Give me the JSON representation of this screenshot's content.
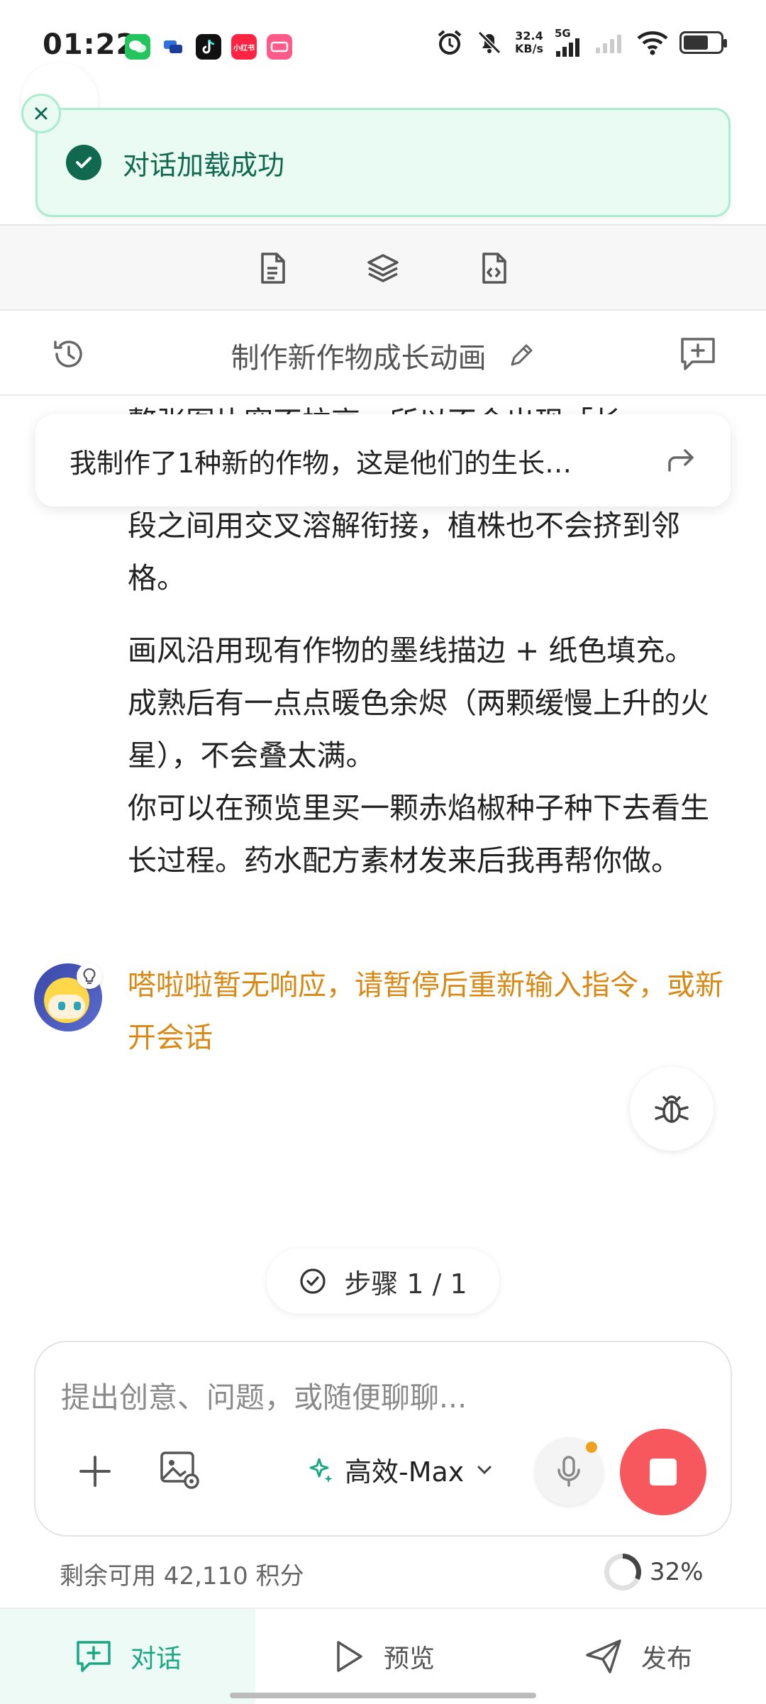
{
  "status_bar": {
    "time": "01:22",
    "net_speed_value": "32.4",
    "net_speed_unit": "KB/s",
    "network": "5G",
    "app_icon_label": "小红书"
  },
  "toast": {
    "message": "对话加载成功"
  },
  "chat": {
    "title": "制作新作物成长动画",
    "prompt_summary": "我制作了1种新的作物，这是他们的生长…",
    "partial_line": "整张图片宽不拉高，所以不会出现「长",
    "paragraph_1": "段之间用交叉溶解衔接，植株也不会挤到邻格。",
    "paragraph_2": "画风沿用现有作物的墨线描边 + 纸色填充。成熟后有一点点暖色余烬（两颗缓慢上升的火星），不会叠太满。",
    "paragraph_3": "你可以在预览里买一颗赤焰椒种子种下去看生长过程。药水配方素材发来后我再帮你做。",
    "warning": "嗒啦啦暂无响应，请暂停后重新输入指令，或新开会话"
  },
  "step": {
    "label": "步骤 1 / 1"
  },
  "input": {
    "placeholder": "提出创意、问题，或随便聊聊...",
    "model": "高效-Max"
  },
  "credits": {
    "text": "剩余可用 42,110 积分",
    "progress": "32%"
  },
  "nav": {
    "chat": "对话",
    "preview": "预览",
    "publish": "发布"
  },
  "colors": {
    "accent": "#1aa882",
    "toast_text": "#10684f",
    "warning": "#d98813",
    "stop_button": "#f6585e"
  }
}
